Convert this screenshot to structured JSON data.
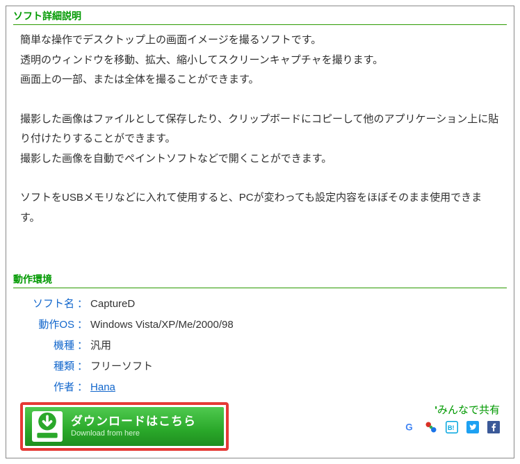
{
  "sections": {
    "description_heading": "ソフト詳細説明",
    "env_heading": "動作環境"
  },
  "description": {
    "p1": "簡単な操作でデスクトップ上の画面イメージを撮るソフトです。",
    "p2": "透明のウィンドウを移動、拡大、縮小してスクリーンキャプチャを撮ります。",
    "p3": "画面上の一部、または全体を撮ることができます。",
    "p4": "撮影した画像はファイルとして保存したり、クリップボードにコピーして他のアプリケーション上に貼り付けたりすることができます。",
    "p5": "撮影した画像を自動でペイントソフトなどで開くことができます。",
    "p6": "ソフトをUSBメモリなどに入れて使用すると、PCが変わっても設定内容をほぼそのまま使用できます。"
  },
  "env": {
    "labels": {
      "name": "ソフト名",
      "os": "動作OS",
      "machine": "機種",
      "type": "種類",
      "author": "作者"
    },
    "values": {
      "name": "CaptureD",
      "os": "Windows Vista/XP/Me/2000/98",
      "machine": "汎用",
      "type": "フリーソフト",
      "author": "Hana"
    }
  },
  "download": {
    "main": "ダウンロードはこちら",
    "sub": "Download from here"
  },
  "share": {
    "title": "みんなで共有"
  }
}
